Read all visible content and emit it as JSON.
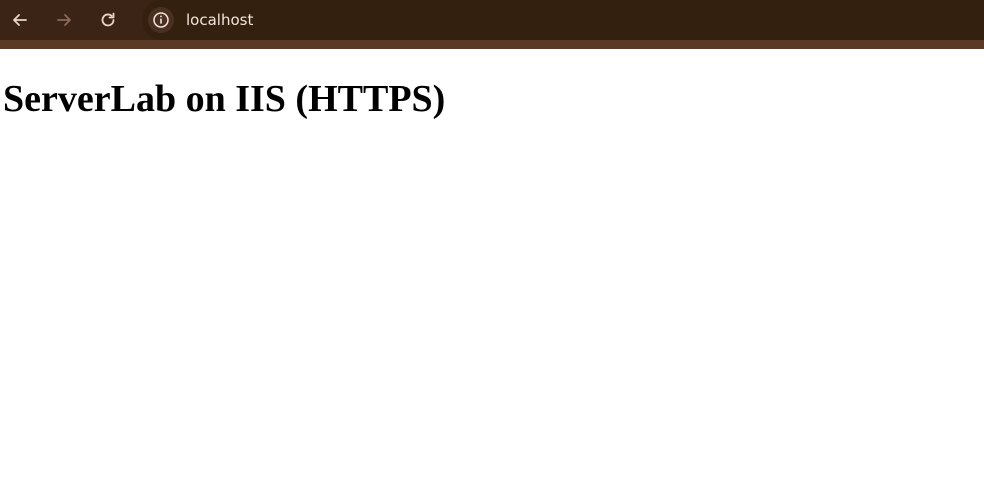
{
  "browser": {
    "url": "localhost",
    "icons": {
      "back": "arrow-left-icon",
      "forward": "arrow-right-icon",
      "reload": "reload-icon",
      "site_info": "info-icon"
    },
    "colors": {
      "toolbar": "#3b2316",
      "strip": "#5b3a25",
      "address_bar": "#34200f",
      "url_text": "#f1e6dc"
    }
  },
  "page": {
    "heading": "ServerLab on IIS (HTTPS)",
    "background": "#ffffff"
  }
}
